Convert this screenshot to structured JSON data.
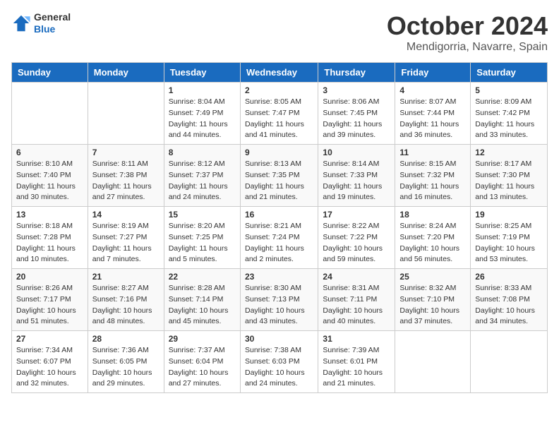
{
  "header": {
    "logo_general": "General",
    "logo_blue": "Blue",
    "month_title": "October 2024",
    "location": "Mendigorria, Navarre, Spain"
  },
  "weekdays": [
    "Sunday",
    "Monday",
    "Tuesday",
    "Wednesday",
    "Thursday",
    "Friday",
    "Saturday"
  ],
  "weeks": [
    [
      null,
      null,
      {
        "day": 1,
        "sunrise": "8:04 AM",
        "sunset": "7:49 PM",
        "daylight": "11 hours and 44 minutes."
      },
      {
        "day": 2,
        "sunrise": "8:05 AM",
        "sunset": "7:47 PM",
        "daylight": "11 hours and 41 minutes."
      },
      {
        "day": 3,
        "sunrise": "8:06 AM",
        "sunset": "7:45 PM",
        "daylight": "11 hours and 39 minutes."
      },
      {
        "day": 4,
        "sunrise": "8:07 AM",
        "sunset": "7:44 PM",
        "daylight": "11 hours and 36 minutes."
      },
      {
        "day": 5,
        "sunrise": "8:09 AM",
        "sunset": "7:42 PM",
        "daylight": "11 hours and 33 minutes."
      }
    ],
    [
      {
        "day": 6,
        "sunrise": "8:10 AM",
        "sunset": "7:40 PM",
        "daylight": "11 hours and 30 minutes."
      },
      {
        "day": 7,
        "sunrise": "8:11 AM",
        "sunset": "7:38 PM",
        "daylight": "11 hours and 27 minutes."
      },
      {
        "day": 8,
        "sunrise": "8:12 AM",
        "sunset": "7:37 PM",
        "daylight": "11 hours and 24 minutes."
      },
      {
        "day": 9,
        "sunrise": "8:13 AM",
        "sunset": "7:35 PM",
        "daylight": "11 hours and 21 minutes."
      },
      {
        "day": 10,
        "sunrise": "8:14 AM",
        "sunset": "7:33 PM",
        "daylight": "11 hours and 19 minutes."
      },
      {
        "day": 11,
        "sunrise": "8:15 AM",
        "sunset": "7:32 PM",
        "daylight": "11 hours and 16 minutes."
      },
      {
        "day": 12,
        "sunrise": "8:17 AM",
        "sunset": "7:30 PM",
        "daylight": "11 hours and 13 minutes."
      }
    ],
    [
      {
        "day": 13,
        "sunrise": "8:18 AM",
        "sunset": "7:28 PM",
        "daylight": "11 hours and 10 minutes."
      },
      {
        "day": 14,
        "sunrise": "8:19 AM",
        "sunset": "7:27 PM",
        "daylight": "11 hours and 7 minutes."
      },
      {
        "day": 15,
        "sunrise": "8:20 AM",
        "sunset": "7:25 PM",
        "daylight": "11 hours and 5 minutes."
      },
      {
        "day": 16,
        "sunrise": "8:21 AM",
        "sunset": "7:24 PM",
        "daylight": "11 hours and 2 minutes."
      },
      {
        "day": 17,
        "sunrise": "8:22 AM",
        "sunset": "7:22 PM",
        "daylight": "10 hours and 59 minutes."
      },
      {
        "day": 18,
        "sunrise": "8:24 AM",
        "sunset": "7:20 PM",
        "daylight": "10 hours and 56 minutes."
      },
      {
        "day": 19,
        "sunrise": "8:25 AM",
        "sunset": "7:19 PM",
        "daylight": "10 hours and 53 minutes."
      }
    ],
    [
      {
        "day": 20,
        "sunrise": "8:26 AM",
        "sunset": "7:17 PM",
        "daylight": "10 hours and 51 minutes."
      },
      {
        "day": 21,
        "sunrise": "8:27 AM",
        "sunset": "7:16 PM",
        "daylight": "10 hours and 48 minutes."
      },
      {
        "day": 22,
        "sunrise": "8:28 AM",
        "sunset": "7:14 PM",
        "daylight": "10 hours and 45 minutes."
      },
      {
        "day": 23,
        "sunrise": "8:30 AM",
        "sunset": "7:13 PM",
        "daylight": "10 hours and 43 minutes."
      },
      {
        "day": 24,
        "sunrise": "8:31 AM",
        "sunset": "7:11 PM",
        "daylight": "10 hours and 40 minutes."
      },
      {
        "day": 25,
        "sunrise": "8:32 AM",
        "sunset": "7:10 PM",
        "daylight": "10 hours and 37 minutes."
      },
      {
        "day": 26,
        "sunrise": "8:33 AM",
        "sunset": "7:08 PM",
        "daylight": "10 hours and 34 minutes."
      }
    ],
    [
      {
        "day": 27,
        "sunrise": "7:34 AM",
        "sunset": "6:07 PM",
        "daylight": "10 hours and 32 minutes."
      },
      {
        "day": 28,
        "sunrise": "7:36 AM",
        "sunset": "6:05 PM",
        "daylight": "10 hours and 29 minutes."
      },
      {
        "day": 29,
        "sunrise": "7:37 AM",
        "sunset": "6:04 PM",
        "daylight": "10 hours and 27 minutes."
      },
      {
        "day": 30,
        "sunrise": "7:38 AM",
        "sunset": "6:03 PM",
        "daylight": "10 hours and 24 minutes."
      },
      {
        "day": 31,
        "sunrise": "7:39 AM",
        "sunset": "6:01 PM",
        "daylight": "10 hours and 21 minutes."
      },
      null,
      null
    ]
  ]
}
